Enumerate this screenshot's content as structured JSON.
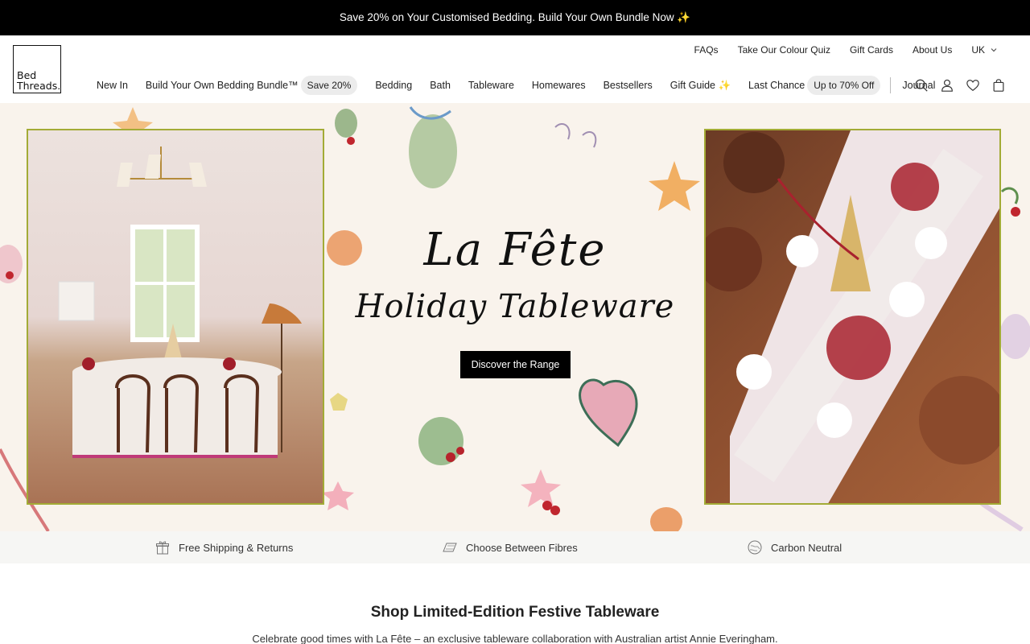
{
  "announcement": {
    "text": "Save 20% on Your Customised Bedding. Build Your Own Bundle Now ✨"
  },
  "logo": {
    "line1": "Bed",
    "line2": "Threads."
  },
  "utility_nav": {
    "faqs": "FAQs",
    "colour_quiz": "Take Our Colour Quiz",
    "gift_cards": "Gift Cards",
    "about_us": "About Us",
    "region": "UK"
  },
  "main_nav": {
    "new_in": "New In",
    "bundle": "Build Your Own Bedding Bundle™",
    "bundle_badge": "Save 20%",
    "bedding": "Bedding",
    "bath": "Bath",
    "tableware": "Tableware",
    "homewares": "Homewares",
    "bestsellers": "Bestsellers",
    "gift_guide": "Gift Guide ✨",
    "last_chance": "Last Chance",
    "last_chance_badge": "Up to 70% Off",
    "journal": "Journal"
  },
  "header_icons": [
    "search-icon",
    "account-icon",
    "wishlist-heart-icon",
    "cart-bag-icon"
  ],
  "hero": {
    "title": "La Fête",
    "subtitle": "Holiday Tableware",
    "cta_label": "Discover the Range"
  },
  "features": {
    "shipping": "Free Shipping & Returns",
    "fibres": "Choose Between Fibres",
    "carbon": "Carbon Neutral"
  },
  "section": {
    "title": "Shop Limited-Edition Festive Tableware",
    "description": "Celebrate good times with La Fête – an exclusive tableware collaboration with Australian artist Annie Everingham."
  },
  "colors": {
    "photo_border": "#a3ab36",
    "hero_bg": "#f9f3ec",
    "announce_bg": "#000000",
    "features_bg": "#f6f6f4"
  }
}
